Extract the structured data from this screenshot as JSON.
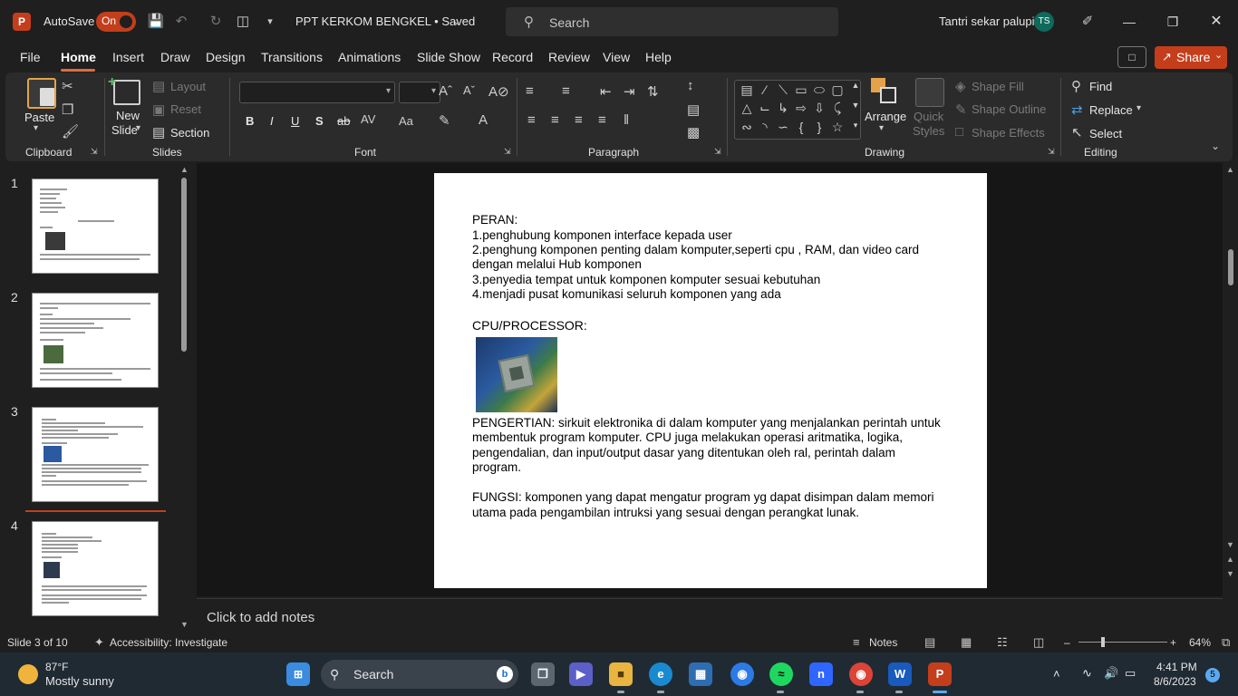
{
  "titlebar": {
    "autosave_label": "AutoSave",
    "autosave_state": "On",
    "doc_title": "PPT KERKOM BENGKEL • Saved",
    "search_placeholder": "Search",
    "user_name": "Tantri sekar palupi",
    "user_initials": "TS"
  },
  "menu": {
    "tabs": [
      "File",
      "Home",
      "Insert",
      "Draw",
      "Design",
      "Transitions",
      "Animations",
      "Slide Show",
      "Record",
      "Review",
      "View",
      "Help"
    ],
    "active": "Home",
    "share_label": "Share"
  },
  "ribbon": {
    "clipboard": {
      "paste": "Paste",
      "group": "Clipboard"
    },
    "slides": {
      "new_slide_1": "New",
      "new_slide_2": "Slide",
      "layout": "Layout",
      "reset": "Reset",
      "section": "Section",
      "group": "Slides"
    },
    "font": {
      "group": "Font",
      "bold": "B",
      "italic": "I",
      "underline": "U",
      "shadow": "S",
      "strike": "ab"
    },
    "paragraph": {
      "group": "Paragraph"
    },
    "drawing": {
      "arrange": "Arrange",
      "quick_styles_1": "Quick",
      "quick_styles_2": "Styles",
      "shape_fill": "Shape Fill",
      "shape_outline": "Shape Outline",
      "shape_effects": "Shape Effects",
      "group": "Drawing"
    },
    "editing": {
      "find": "Find",
      "replace": "Replace",
      "select": "Select",
      "group": "Editing"
    }
  },
  "thumbnails": [
    {
      "num": "1"
    },
    {
      "num": "2"
    },
    {
      "num": "3",
      "active": true
    },
    {
      "num": "4"
    }
  ],
  "slide": {
    "lines": [
      "PERAN:",
      "1.penghubung komponen interface kepada user",
      "2.penghung komponen penting dalam komputer,seperti cpu , RAM, dan video card",
      "dengan melalui Hub komponen",
      "3.penyedia tempat untuk komponen komputer sesuai kebutuhan",
      "4.menjadi pusat komunikasi seluruh komponen yang ada",
      "CPU/PROCESSOR:",
      "PENGERTIAN: sirkuit elektronika di dalam komputer yang menjalankan perintah untuk",
      "membentuk program komputer. CPU juga melakukan operasi aritmatika, logika,",
      "pengendalian, dan input/output dasar yang ditentukan oleh ral, perintah dalam",
      "program.",
      "FUNGSI: komponen yang dapat mengatur program yg dapat disimpan dalam memori",
      "utama pada pengambilan intruksi yang sesuai dengan perangkat lunak."
    ]
  },
  "notes": {
    "placeholder": "Click to add notes"
  },
  "status": {
    "slide_info": "Slide 3 of 10",
    "accessibility": "Accessibility: Investigate",
    "notes_label": "Notes",
    "zoom": "64%"
  },
  "taskbar": {
    "temperature": "87°F",
    "weather": "Mostly sunny",
    "search": "Search",
    "time": "4:41 PM",
    "date": "8/6/2023",
    "notification_count": "5"
  },
  "colors": {
    "accent": "#c43e1c",
    "ribbon_bg": "#2b2b2b",
    "app_bg": "#1f1f1f"
  }
}
